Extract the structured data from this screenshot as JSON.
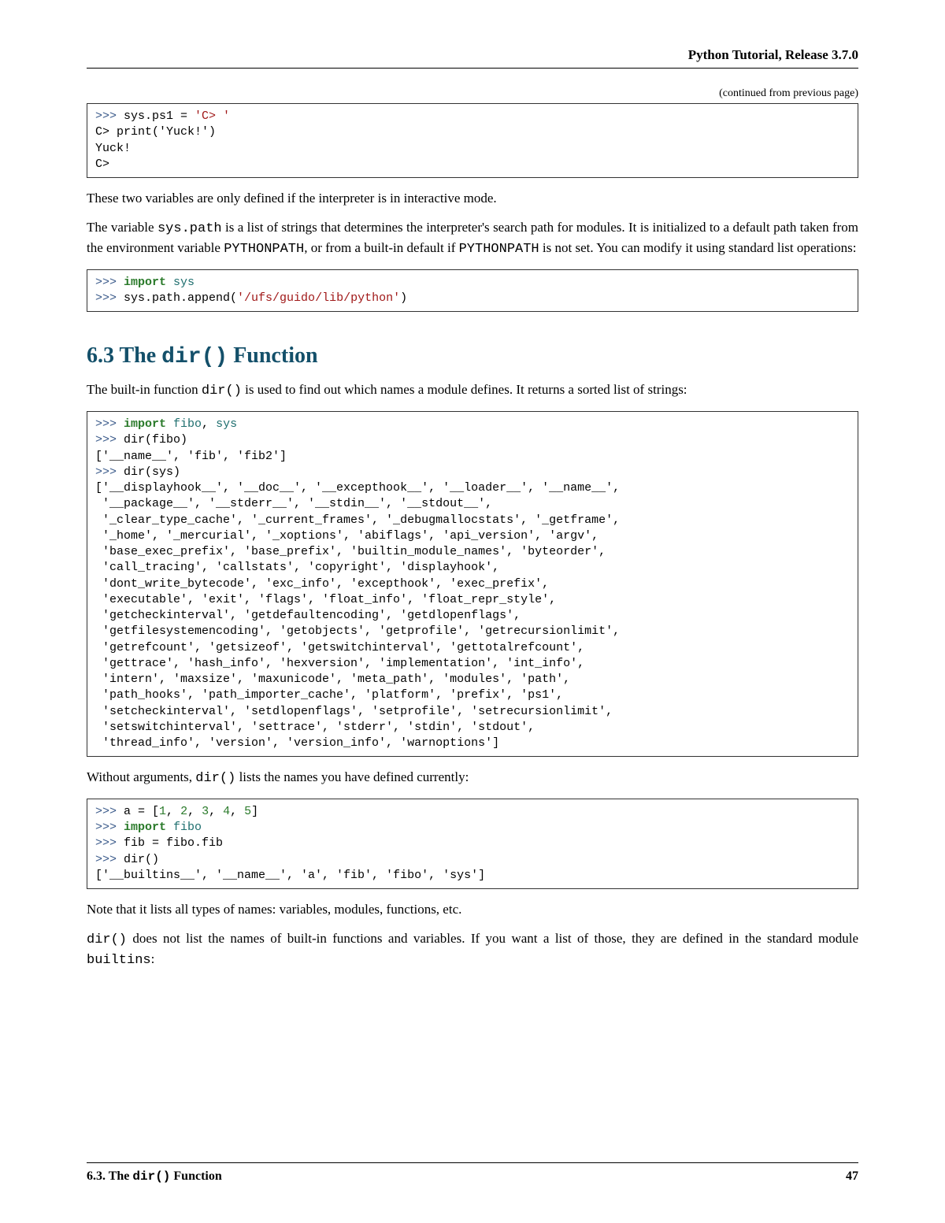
{
  "header": {
    "title": "Python Tutorial, Release 3.7.0"
  },
  "continued_label": "(continued from previous page)",
  "code1": {
    "line1_prompt": ">>> ",
    "line1_rest": "sys.ps1 = ",
    "line1_str": "'C> '",
    "line2": "C> print('Yuck!')",
    "line3": "Yuck!",
    "line4": "C>"
  },
  "para1": "These two variables are only defined if the interpreter is in interactive mode.",
  "para2_a": "The variable ",
  "para2_code1": "sys.path",
  "para2_b": " is a list of strings that determines the interpreter's search path for modules. It is initialized to a default path taken from the environment variable ",
  "para2_code2": "PYTHONPATH",
  "para2_c": ", or from a built-in default if ",
  "para2_code3": "PYTHONPATH",
  "para2_d": " is not set. You can modify it using standard list operations:",
  "code2": {
    "l1_prompt": ">>> ",
    "l1_kw": "import",
    "l1_mod": " sys",
    "l2_prompt": ">>> ",
    "l2_rest": "sys.path.append(",
    "l2_str": "'/ufs/guido/lib/python'",
    "l2_close": ")"
  },
  "section": {
    "number": "6.3",
    "title_a": " The ",
    "title_code": "dir()",
    "title_b": " Function"
  },
  "para3_a": "The built-in function ",
  "para3_code": "dir()",
  "para3_b": " is used to find out which names a module defines. It returns a sorted list of strings:",
  "code3": {
    "l1_prompt": ">>> ",
    "l1_kw": "import",
    "l1_mod1": " fibo",
    "l1_sep": ",",
    "l1_mod2": " sys",
    "l2_prompt": ">>> ",
    "l2_rest": "dir(fibo)",
    "l3": "['__name__', 'fib', 'fib2']",
    "l4_prompt": ">>> ",
    "l4_rest": "dir(sys)",
    "l5": "['__displayhook__', '__doc__', '__excepthook__', '__loader__', '__name__',",
    "l6": " '__package__', '__stderr__', '__stdin__', '__stdout__',",
    "l7": " '_clear_type_cache', '_current_frames', '_debugmallocstats', '_getframe',",
    "l8": " '_home', '_mercurial', '_xoptions', 'abiflags', 'api_version', 'argv',",
    "l9": " 'base_exec_prefix', 'base_prefix', 'builtin_module_names', 'byteorder',",
    "l10": " 'call_tracing', 'callstats', 'copyright', 'displayhook',",
    "l11": " 'dont_write_bytecode', 'exc_info', 'excepthook', 'exec_prefix',",
    "l12": " 'executable', 'exit', 'flags', 'float_info', 'float_repr_style',",
    "l13": " 'getcheckinterval', 'getdefaultencoding', 'getdlopenflags',",
    "l14": " 'getfilesystemencoding', 'getobjects', 'getprofile', 'getrecursionlimit',",
    "l15": " 'getrefcount', 'getsizeof', 'getswitchinterval', 'gettotalrefcount',",
    "l16": " 'gettrace', 'hash_info', 'hexversion', 'implementation', 'int_info',",
    "l17": " 'intern', 'maxsize', 'maxunicode', 'meta_path', 'modules', 'path',",
    "l18": " 'path_hooks', 'path_importer_cache', 'platform', 'prefix', 'ps1',",
    "l19": " 'setcheckinterval', 'setdlopenflags', 'setprofile', 'setrecursionlimit',",
    "l20": " 'setswitchinterval', 'settrace', 'stderr', 'stdin', 'stdout',",
    "l21": " 'thread_info', 'version', 'version_info', 'warnoptions']"
  },
  "para4_a": "Without arguments, ",
  "para4_code": "dir()",
  "para4_b": " lists the names you have defined currently:",
  "code4": {
    "l1_prompt": ">>> ",
    "l1_a": "a = [",
    "l1_n1": "1",
    "l1_s1": ", ",
    "l1_n2": "2",
    "l1_s2": ", ",
    "l1_n3": "3",
    "l1_s3": ", ",
    "l1_n4": "4",
    "l1_s4": ", ",
    "l1_n5": "5",
    "l1_close": "]",
    "l2_prompt": ">>> ",
    "l2_kw": "import",
    "l2_mod": " fibo",
    "l3_prompt": ">>> ",
    "l3_rest": "fib = fibo.fib",
    "l4_prompt": ">>> ",
    "l4_rest": "dir()",
    "l5": "['__builtins__', '__name__', 'a', 'fib', 'fibo', 'sys']"
  },
  "para5": "Note that it lists all types of names: variables, modules, functions, etc.",
  "para6_code": "dir()",
  "para6_a": " does not list the names of built-in functions and variables. If you want a list of those, they are defined in the standard module ",
  "para6_code2": "builtins",
  "para6_b": ":",
  "footer": {
    "left_a": "6.3.   The ",
    "left_code": "dir()",
    "left_b": " Function",
    "page": "47"
  }
}
